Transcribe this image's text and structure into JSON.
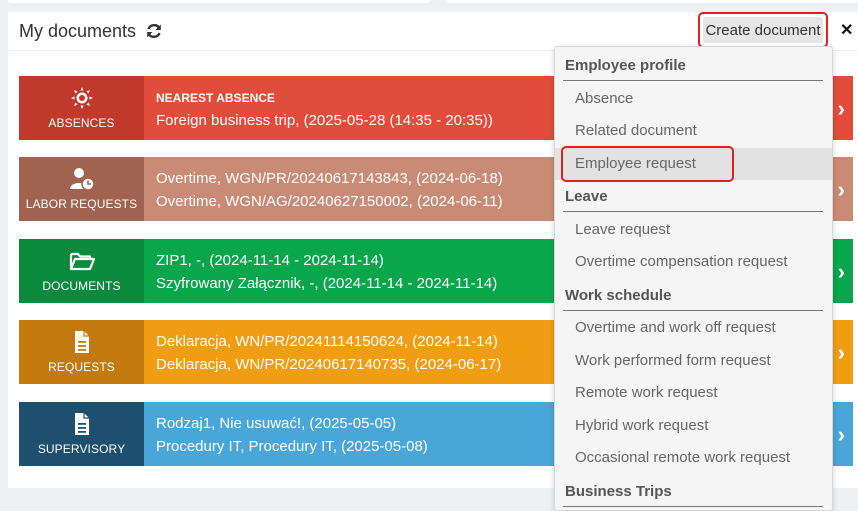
{
  "header": {
    "title": "My documents",
    "create_label": "Create document"
  },
  "tiles": [
    {
      "label": "ABSENCES",
      "icon": "sun-icon",
      "line1": "NEAREST ABSENCE",
      "line2": "Foreign business trip, (2025-05-28 (14:35 - 20:35))",
      "side_color": "#c0392b",
      "body_color": "#e14c3b"
    },
    {
      "label": "LABOR REQUESTS",
      "icon": "user-clock-icon",
      "line1": "Overtime, WGN/PR/20240617143843, (2024-06-18)",
      "line2": "Overtime, WGN/AG/20240627150002, (2024-06-11)",
      "side_color": "#a0634f",
      "body_color": "#c98b76"
    },
    {
      "label": "DOCUMENTS",
      "icon": "folder-open-icon",
      "line1": "ZIP1, -, (2024-11-14 - 2024-11-14)",
      "line2": "Szyfrowany Załącznik, -, (2024-11-14 - 2024-11-14)",
      "side_color": "#0b8a3e",
      "body_color": "#0aa64c"
    },
    {
      "label": "REQUESTS",
      "icon": "document-icon",
      "line1": "Deklaracja, WN/PR/20241114150624, (2024-11-14)",
      "line2": "Deklaracja, WN/PR/20240617140735, (2024-06-17)",
      "side_color": "#c27a0e",
      "body_color": "#f09d14"
    },
    {
      "label": "SUPERVISORY",
      "icon": "document-icon",
      "line1": "Rodzaj1, Nie usuwać!, (2025-05-05)",
      "line2": "Procedury IT, Procedury IT, (2025-05-08)",
      "side_color": "#1f4f6f",
      "body_color": "#4aa6d8"
    }
  ],
  "dropdown": {
    "sections": [
      {
        "title": "Employee profile",
        "items": [
          "Absence",
          "Related document",
          "Employee request"
        ]
      },
      {
        "title": "Leave",
        "items": [
          "Leave request",
          "Overtime compensation request"
        ]
      },
      {
        "title": "Work schedule",
        "items": [
          "Overtime and work off request",
          "Work performed form request",
          "Remote work request",
          "Hybrid work request",
          "Occasional remote work request"
        ]
      },
      {
        "title": "Business Trips",
        "items": []
      }
    ],
    "active_item": "Employee request"
  }
}
